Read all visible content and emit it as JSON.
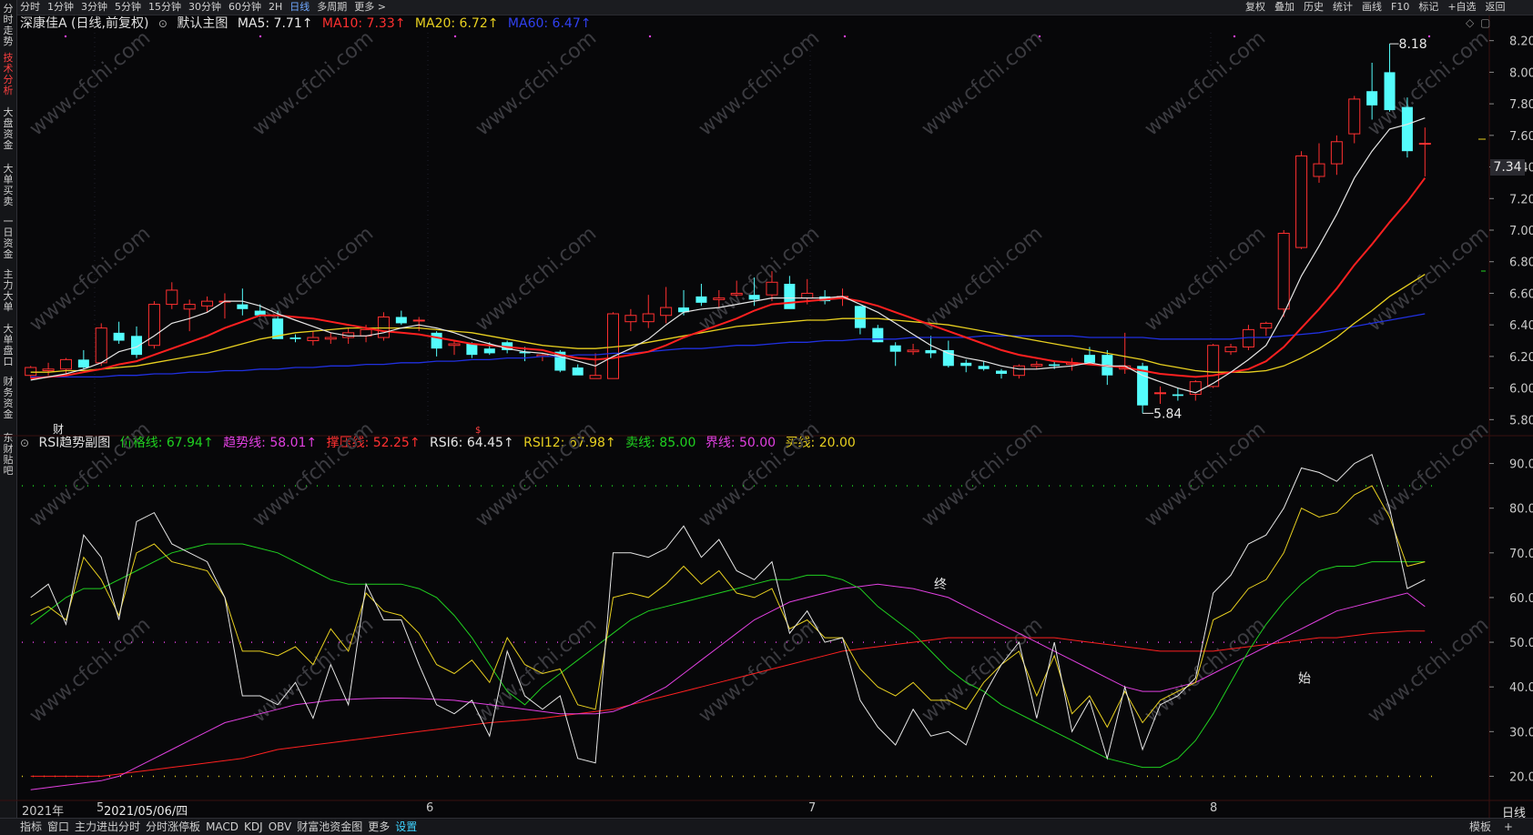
{
  "top_bar": {
    "periods": [
      "分时",
      "1分钟",
      "3分钟",
      "5分钟",
      "15分钟",
      "30分钟",
      "60分钟",
      "2H",
      "日线",
      "多周期",
      "更多 >"
    ],
    "active_period": "日线",
    "right_tools": [
      "复权",
      "叠加",
      "历史",
      "统计",
      "画线",
      "F10",
      "标记",
      "+自选",
      "返回"
    ]
  },
  "left_tabs": [
    "分时走势",
    "技术分析",
    "大盘资金",
    "大单买卖",
    "一日资金",
    "主力大单",
    "大单盘口",
    "财务资金",
    "东财贴吧"
  ],
  "active_left_tab": "技术分析",
  "main_legend": {
    "title": "深康佳A (日线,前复权)",
    "indicator": "默认主图",
    "ma5": "MA5: 7.71↑",
    "ma10": "MA10: 7.33↑",
    "ma20": "MA20: 6.72↑",
    "ma60": "MA60: 6.47↑"
  },
  "sub_legend": {
    "title": "RSI趋势副图",
    "price_line": "价格线: 67.94↑",
    "trend_line": "趋势线: 58.01↑",
    "press_line": "撑压线: 52.25↑",
    "rsi6": "RSI6: 64.45↑",
    "rsi12": "RSI12: 67.98↑",
    "sell_line": "卖线: 85.00",
    "boundary_line": "界线: 50.00",
    "buy_line": "买线: 20.00"
  },
  "main_axis_ticks": [
    "8.20",
    "8.00",
    "7.80",
    "7.60",
    "7.40",
    "7.20",
    "7.00",
    "6.80",
    "6.60",
    "6.40",
    "6.20",
    "6.00",
    "5.80"
  ],
  "sub_axis_ticks": [
    "90.00",
    "80.00",
    "70.00",
    "60.00",
    "50.00",
    "40.00",
    "30.00",
    "20.00"
  ],
  "current_price": "7.34",
  "high_label": "8.18",
  "low_label": "5.84",
  "chart_markers": {
    "cai": "财",
    "zhong": "终",
    "shi": "始"
  },
  "x_labels": [
    "2021年",
    "5",
    "2021/05/06/四",
    "6",
    "7",
    "8"
  ],
  "bottom_tabs": [
    "指标",
    "窗口",
    "主力进出分时",
    "分时涨停板",
    "MACD",
    "KDJ",
    "OBV",
    "财富池资金图",
    "更多",
    "设置"
  ],
  "active_bottom_tab": "设置",
  "bottom_right": [
    "模板",
    "+",
    "日线"
  ],
  "watermark": "www.cfchi.com",
  "colors": {
    "up": "#ff3030",
    "down": "#54fcfc",
    "ma5": "#e6e6e6",
    "ma10": "#ff2020",
    "ma20": "#e8d020",
    "ma60": "#2030e0",
    "magenta": "#e040e0",
    "green": "#20d020"
  },
  "chart_data": {
    "type": "candlestick",
    "ohlc": [
      [
        6.08,
        6.14,
        6.06,
        6.13
      ],
      [
        6.11,
        6.16,
        6.08,
        6.12
      ],
      [
        6.12,
        6.19,
        6.09,
        6.18
      ],
      [
        6.18,
        6.24,
        6.12,
        6.13
      ],
      [
        6.16,
        6.41,
        6.14,
        6.38
      ],
      [
        6.35,
        6.42,
        6.28,
        6.3
      ],
      [
        6.33,
        6.39,
        6.19,
        6.21
      ],
      [
        6.27,
        6.55,
        6.25,
        6.53
      ],
      [
        6.53,
        6.67,
        6.5,
        6.62
      ],
      [
        6.5,
        6.56,
        6.36,
        6.53
      ],
      [
        6.52,
        6.58,
        6.48,
        6.55
      ],
      [
        6.55,
        6.6,
        6.44,
        6.55
      ],
      [
        6.53,
        6.63,
        6.46,
        6.5
      ],
      [
        6.49,
        6.53,
        6.45,
        6.46
      ],
      [
        6.44,
        6.49,
        6.31,
        6.31
      ],
      [
        6.32,
        6.34,
        6.29,
        6.31
      ],
      [
        6.3,
        6.36,
        6.27,
        6.32
      ],
      [
        6.31,
        6.35,
        6.28,
        6.32
      ],
      [
        6.32,
        6.38,
        6.28,
        6.35
      ],
      [
        6.33,
        6.4,
        6.29,
        6.37
      ],
      [
        6.32,
        6.48,
        6.3,
        6.45
      ],
      [
        6.45,
        6.49,
        6.4,
        6.41
      ],
      [
        6.43,
        6.45,
        6.36,
        6.43
      ],
      [
        6.35,
        6.36,
        6.2,
        6.25
      ],
      [
        6.27,
        6.3,
        6.21,
        6.28
      ],
      [
        6.28,
        6.29,
        6.19,
        6.21
      ],
      [
        6.25,
        6.29,
        6.21,
        6.22
      ],
      [
        6.29,
        6.3,
        6.22,
        6.24
      ],
      [
        6.23,
        6.26,
        6.17,
        6.22
      ],
      [
        6.2,
        6.22,
        6.17,
        6.21
      ],
      [
        6.23,
        6.24,
        6.1,
        6.11
      ],
      [
        6.13,
        6.15,
        6.09,
        6.08
      ],
      [
        6.06,
        6.22,
        6.06,
        6.08
      ],
      [
        6.06,
        6.48,
        6.06,
        6.47
      ],
      [
        6.42,
        6.5,
        6.36,
        6.46
      ],
      [
        6.42,
        6.59,
        6.38,
        6.47
      ],
      [
        6.46,
        6.64,
        6.41,
        6.51
      ],
      [
        6.51,
        6.62,
        6.46,
        6.48
      ],
      [
        6.58,
        6.66,
        6.52,
        6.54
      ],
      [
        6.56,
        6.62,
        6.51,
        6.57
      ],
      [
        6.59,
        6.68,
        6.58,
        6.6
      ],
      [
        6.59,
        6.7,
        6.52,
        6.56
      ],
      [
        6.59,
        6.74,
        6.55,
        6.67
      ],
      [
        6.66,
        6.71,
        6.51,
        6.5
      ],
      [
        6.57,
        6.69,
        6.53,
        6.6
      ],
      [
        6.58,
        6.62,
        6.53,
        6.55
      ],
      [
        6.58,
        6.63,
        6.52,
        6.58
      ],
      [
        6.52,
        6.52,
        6.34,
        6.38
      ],
      [
        6.38,
        6.4,
        6.29,
        6.29
      ],
      [
        6.27,
        6.29,
        6.14,
        6.23
      ],
      [
        6.23,
        6.28,
        6.21,
        6.24
      ],
      [
        6.24,
        6.33,
        6.19,
        6.22
      ],
      [
        6.24,
        6.3,
        6.13,
        6.14
      ],
      [
        6.16,
        6.18,
        6.1,
        6.14
      ],
      [
        6.14,
        6.17,
        6.11,
        6.12
      ],
      [
        6.11,
        6.12,
        6.06,
        6.09
      ],
      [
        6.08,
        6.15,
        6.06,
        6.14
      ],
      [
        6.14,
        6.17,
        6.12,
        6.15
      ],
      [
        6.15,
        6.17,
        6.12,
        6.14
      ],
      [
        6.15,
        6.19,
        6.11,
        6.16
      ],
      [
        6.21,
        6.26,
        6.15,
        6.16
      ],
      [
        6.21,
        6.24,
        6.02,
        6.08
      ],
      [
        6.12,
        6.35,
        6.09,
        6.14
      ],
      [
        6.14,
        6.16,
        5.84,
        5.89
      ],
      [
        5.97,
        6.01,
        5.9,
        5.97
      ],
      [
        5.96,
        6.0,
        5.92,
        5.95
      ],
      [
        5.96,
        6.05,
        5.92,
        6.04
      ],
      [
        6.01,
        6.28,
        6.0,
        6.27
      ],
      [
        6.23,
        6.28,
        6.21,
        6.26
      ],
      [
        6.26,
        6.4,
        6.24,
        6.37
      ],
      [
        6.38,
        6.42,
        6.33,
        6.41
      ],
      [
        6.5,
        7.0,
        6.45,
        6.98
      ],
      [
        6.89,
        7.5,
        6.88,
        7.47
      ],
      [
        7.34,
        7.55,
        7.3,
        7.42
      ],
      [
        7.42,
        7.6,
        7.35,
        7.56
      ],
      [
        7.61,
        7.85,
        7.55,
        7.83
      ],
      [
        7.88,
        8.06,
        7.7,
        7.79
      ],
      [
        8.0,
        8.18,
        7.75,
        7.76
      ],
      [
        7.78,
        7.84,
        7.46,
        7.5
      ],
      [
        7.55,
        7.65,
        7.34,
        7.55
      ]
    ],
    "ma5": [
      6.05,
      6.07,
      6.09,
      6.12,
      6.16,
      6.23,
      6.26,
      6.33,
      6.41,
      6.44,
      6.48,
      6.55,
      6.55,
      6.52,
      6.47,
      6.43,
      6.39,
      6.35,
      6.33,
      6.33,
      6.35,
      6.38,
      6.4,
      6.38,
      6.35,
      6.31,
      6.28,
      6.25,
      6.23,
      6.22,
      6.2,
      6.17,
      6.14,
      6.2,
      6.25,
      6.31,
      6.4,
      6.48,
      6.5,
      6.51,
      6.53,
      6.55,
      6.57,
      6.57,
      6.57,
      6.57,
      6.58,
      6.53,
      6.48,
      6.41,
      6.34,
      6.27,
      6.22,
      6.19,
      6.17,
      6.14,
      6.12,
      6.12,
      6.13,
      6.14,
      6.16,
      6.14,
      6.14,
      6.08,
      6.04,
      6.0,
      5.97,
      6.03,
      6.1,
      6.18,
      6.27,
      6.47,
      6.71,
      6.9,
      7.1,
      7.33,
      7.5,
      7.64,
      7.67,
      7.71
    ],
    "ma10": [
      6.06,
      6.07,
      6.08,
      6.1,
      6.12,
      6.15,
      6.17,
      6.21,
      6.25,
      6.29,
      6.33,
      6.38,
      6.42,
      6.46,
      6.46,
      6.45,
      6.44,
      6.42,
      6.4,
      6.38,
      6.36,
      6.35,
      6.34,
      6.32,
      6.3,
      6.28,
      6.27,
      6.26,
      6.25,
      6.24,
      6.21,
      6.19,
      6.18,
      6.19,
      6.21,
      6.23,
      6.27,
      6.32,
      6.36,
      6.4,
      6.44,
      6.49,
      6.53,
      6.54,
      6.55,
      6.56,
      6.57,
      6.55,
      6.52,
      6.48,
      6.44,
      6.4,
      6.36,
      6.32,
      6.28,
      6.24,
      6.21,
      6.19,
      6.17,
      6.16,
      6.15,
      6.14,
      6.13,
      6.11,
      6.09,
      6.08,
      6.07,
      6.08,
      6.1,
      6.12,
      6.17,
      6.26,
      6.38,
      6.5,
      6.63,
      6.78,
      6.91,
      7.05,
      7.18,
      7.33
    ],
    "ma20": [
      6.1,
      6.1,
      6.11,
      6.11,
      6.12,
      6.13,
      6.14,
      6.16,
      6.18,
      6.2,
      6.22,
      6.25,
      6.28,
      6.31,
      6.33,
      6.35,
      6.36,
      6.37,
      6.38,
      6.38,
      6.38,
      6.38,
      6.38,
      6.37,
      6.36,
      6.35,
      6.33,
      6.31,
      6.29,
      6.27,
      6.26,
      6.25,
      6.25,
      6.26,
      6.27,
      6.29,
      6.31,
      6.33,
      6.35,
      6.37,
      6.39,
      6.4,
      6.41,
      6.42,
      6.43,
      6.43,
      6.44,
      6.44,
      6.44,
      6.43,
      6.42,
      6.41,
      6.4,
      6.38,
      6.36,
      6.34,
      6.32,
      6.3,
      6.28,
      6.26,
      6.24,
      6.22,
      6.2,
      6.18,
      6.15,
      6.13,
      6.11,
      6.1,
      6.1,
      6.1,
      6.11,
      6.14,
      6.19,
      6.25,
      6.32,
      6.41,
      6.49,
      6.58,
      6.65,
      6.72
    ],
    "ma60": [
      6.07,
      6.07,
      6.07,
      6.07,
      6.07,
      6.08,
      6.08,
      6.09,
      6.09,
      6.1,
      6.1,
      6.11,
      6.11,
      6.12,
      6.12,
      6.13,
      6.13,
      6.14,
      6.14,
      6.15,
      6.15,
      6.16,
      6.16,
      6.17,
      6.17,
      6.18,
      6.18,
      6.19,
      6.19,
      6.2,
      6.2,
      6.21,
      6.21,
      6.22,
      6.22,
      6.23,
      6.24,
      6.25,
      6.25,
      6.26,
      6.27,
      6.27,
      6.28,
      6.29,
      6.29,
      6.3,
      6.3,
      6.31,
      6.31,
      6.31,
      6.32,
      6.32,
      6.32,
      6.32,
      6.33,
      6.33,
      6.33,
      6.33,
      6.33,
      6.33,
      6.32,
      6.32,
      6.32,
      6.32,
      6.31,
      6.31,
      6.31,
      6.31,
      6.31,
      6.32,
      6.32,
      6.33,
      6.34,
      6.35,
      6.37,
      6.39,
      6.41,
      6.43,
      6.45,
      6.47
    ],
    "sub_ylim": [
      15,
      95
    ],
    "ylim": [
      5.75,
      8.25
    ],
    "rsi_white": [
      60,
      63,
      54,
      74,
      69,
      55,
      77,
      79,
      72,
      70,
      68,
      60,
      38,
      38,
      36,
      41,
      33,
      45,
      36,
      63,
      55,
      55,
      45,
      36,
      34,
      37,
      29,
      48,
      38,
      35,
      38,
      24,
      23,
      70,
      70,
      69,
      71,
      76,
      69,
      73,
      66,
      64,
      68,
      52,
      57,
      50,
      51,
      37,
      31,
      27,
      35,
      29,
      30,
      27,
      38,
      45,
      50,
      33,
      50,
      30,
      37,
      24,
      40,
      26,
      36,
      38,
      42,
      61,
      65,
      72,
      74,
      80,
      89,
      88,
      86,
      90,
      92,
      80,
      62,
      64
    ],
    "rsi_yellow": [
      56,
      58,
      55,
      69,
      64,
      56,
      70,
      72,
      68,
      67,
      66,
      60,
      48,
      48,
      47,
      49,
      45,
      53,
      48,
      61,
      57,
      56,
      52,
      45,
      43,
      46,
      41,
      51,
      45,
      43,
      44,
      36,
      35,
      60,
      61,
      60,
      63,
      67,
      63,
      66,
      61,
      60,
      62,
      53,
      55,
      51,
      51,
      44,
      40,
      38,
      41,
      37,
      37,
      35,
      41,
      45,
      48,
      38,
      47,
      34,
      38,
      31,
      39,
      32,
      37,
      39,
      41,
      55,
      57,
      62,
      64,
      70,
      80,
      78,
      79,
      83,
      85,
      78,
      67,
      68
    ],
    "rsi_green": [
      54,
      57,
      60,
      62,
      62,
      64,
      66,
      68,
      70,
      71,
      72,
      72,
      72,
      71,
      70,
      68,
      66,
      64,
      63,
      63,
      63,
      63,
      62,
      60,
      56,
      51,
      45,
      39,
      36,
      40,
      43,
      46,
      49,
      52,
      55,
      57,
      58,
      59,
      60,
      61,
      62,
      63,
      64,
      64,
      65,
      65,
      64,
      62,
      58,
      55,
      52,
      48,
      44,
      41,
      39,
      36,
      34,
      32,
      30,
      28,
      26,
      24,
      23,
      22,
      22,
      24,
      28,
      34,
      41,
      48,
      54,
      59,
      63,
      66,
      67,
      67,
      68,
      68,
      68,
      68
    ],
    "rsi_magenta": [
      17,
      17.5,
      18,
      18.5,
      19,
      20,
      22,
      24,
      26,
      28,
      30,
      32,
      33,
      34,
      35,
      36,
      36.5,
      37,
      37.2,
      37.4,
      37.5,
      37.5,
      37.4,
      37.2,
      37,
      36.5,
      36,
      35.5,
      35,
      34.5,
      34,
      34,
      34,
      34.5,
      36,
      38,
      40,
      43,
      46,
      49,
      52,
      55,
      57,
      59,
      60,
      61,
      62,
      62.5,
      63,
      62.5,
      62,
      61,
      60,
      58,
      56,
      54,
      52,
      50,
      48,
      46,
      44,
      42,
      40,
      39,
      39,
      40,
      41,
      43,
      45,
      47,
      49,
      51,
      53,
      55,
      57,
      58,
      59,
      60,
      61,
      58
    ],
    "rsi_red": [
      20,
      20,
      20,
      20,
      20,
      20.5,
      21,
      21.5,
      22,
      22.5,
      23,
      23.5,
      24,
      25,
      26,
      26.5,
      27,
      27.5,
      28,
      28.5,
      29,
      29.5,
      30,
      30.5,
      31,
      31.5,
      32,
      32.3,
      32.6,
      33,
      33.5,
      34,
      34.5,
      35,
      36,
      37,
      38,
      39,
      40,
      41,
      42,
      43,
      44,
      45,
      46,
      47,
      48,
      48.5,
      49,
      49.5,
      50,
      50.5,
      51,
      51,
      51,
      51,
      51,
      51,
      51,
      50.5,
      50,
      49.5,
      49,
      48.5,
      48,
      48,
      48,
      48,
      48.5,
      49,
      49.5,
      50,
      50.5,
      51,
      51,
      51.5,
      52,
      52.25,
      52.5,
      52.5
    ]
  }
}
